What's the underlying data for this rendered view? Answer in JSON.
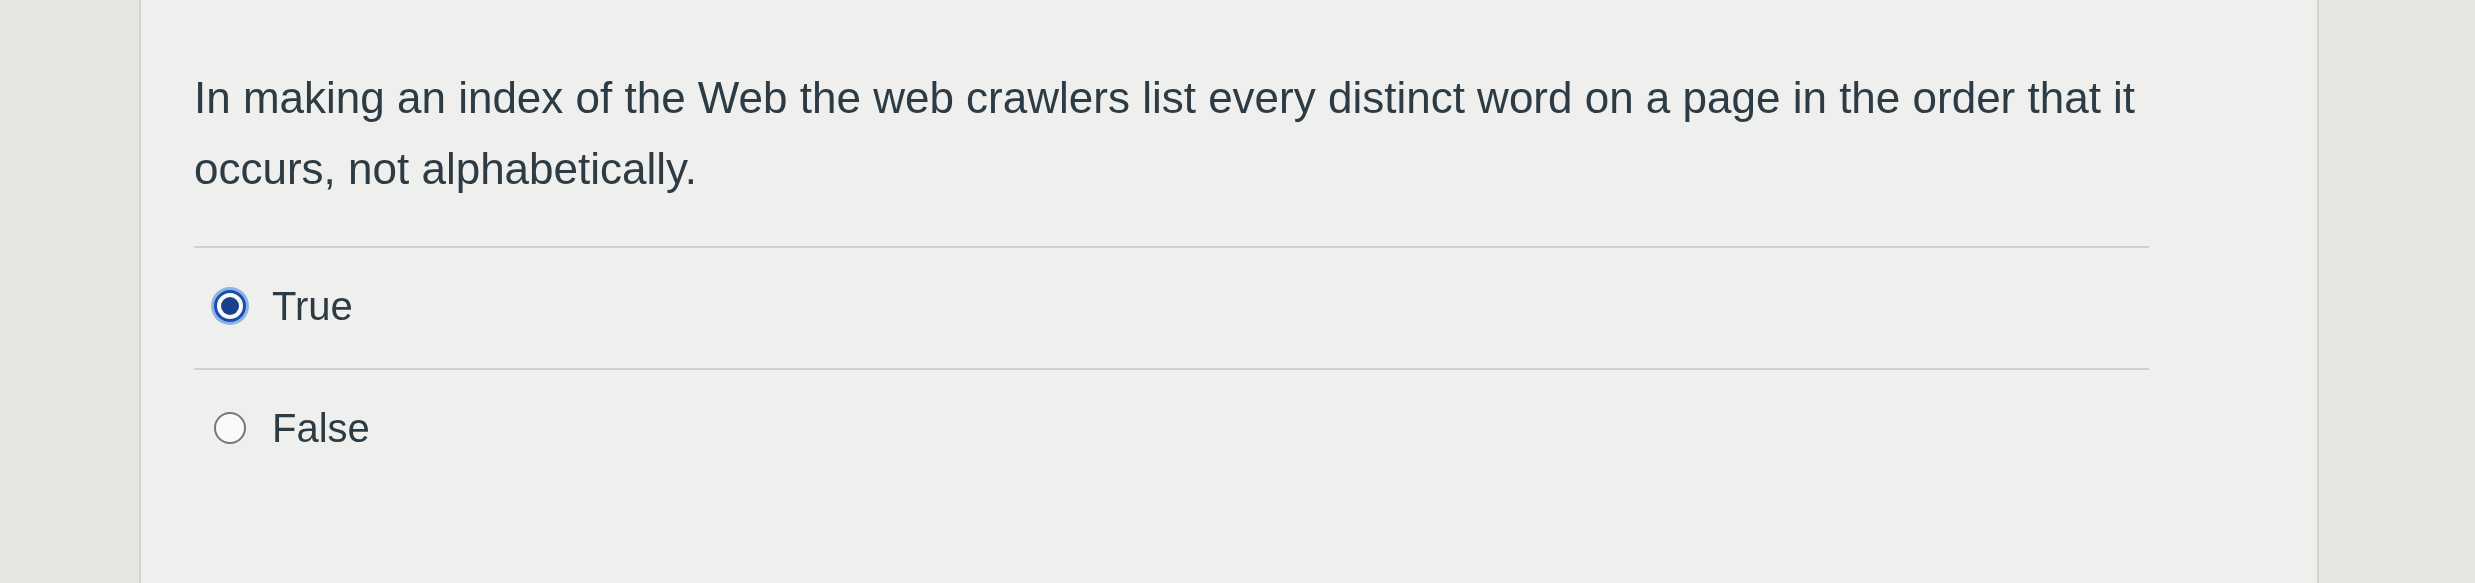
{
  "question": {
    "text": "In making an index of the Web the web crawlers list every distinct word on a page in the order that it occurs, not alphabetically.",
    "options": [
      {
        "label": "True",
        "selected": true
      },
      {
        "label": "False",
        "selected": false
      }
    ]
  }
}
